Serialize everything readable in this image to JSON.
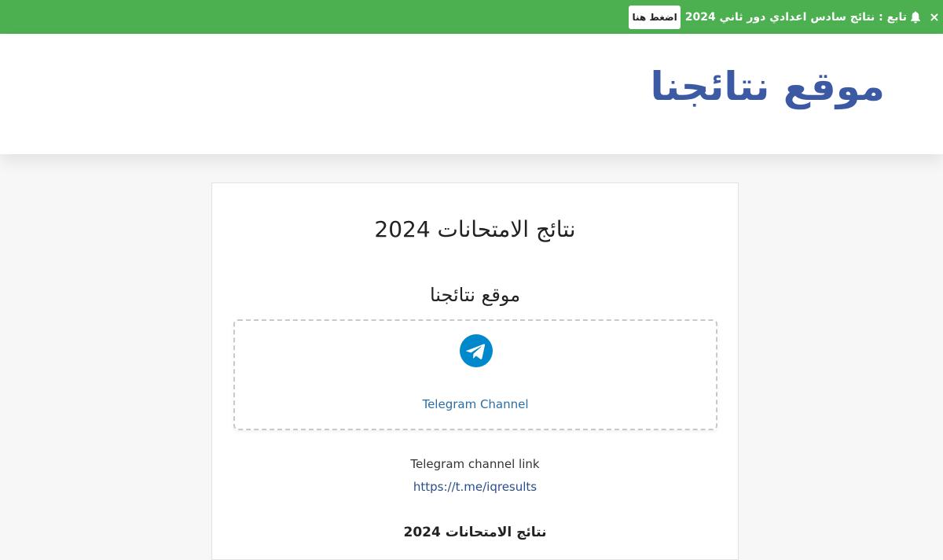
{
  "notification_bar": {
    "background_color": "#4caf50",
    "button_label": "اضغط هنا",
    "message": "تابع : نتائج سادس اعدادي دور ثاني 2024",
    "bell_icon": "bell-icon",
    "close_symbol": "×"
  },
  "header": {
    "site_title": "موقع نتائجنا",
    "title_color": "#3b5aa3"
  },
  "card": {
    "heading": "نتائج الامتحانات 2024",
    "subheading": "موقع نتائجنا",
    "telegram_box": {
      "icon": "telegram-icon",
      "icon_color": "#0088cc",
      "label": "Telegram Channel"
    },
    "link_caption": "Telegram channel link",
    "link_url": "https://t.me/iqresults",
    "section_heading": "نتائج الامتحانات 2024"
  }
}
